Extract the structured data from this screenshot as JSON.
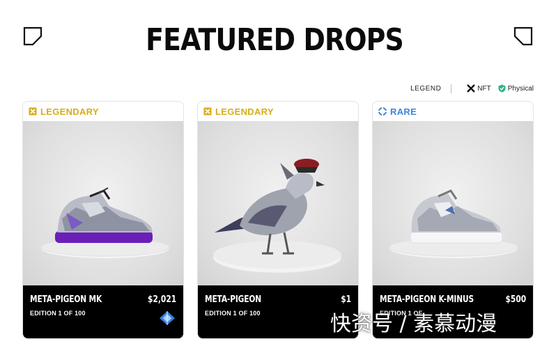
{
  "header": {
    "title": "FEATURED DROPS"
  },
  "legend": {
    "label": "LEGEND",
    "nft_label": "NFT",
    "physical_label": "Physical"
  },
  "cards": [
    {
      "tier": "LEGENDARY",
      "tier_icon": "legendary-icon",
      "tier_color": "#d6ad1a",
      "name": "META-PIGEON MK",
      "price": "$2,021",
      "edition": "EDITION 1 OF 100",
      "image": "purple-silver-sneaker"
    },
    {
      "tier": "LEGENDARY",
      "tier_icon": "legendary-icon",
      "tier_color": "#d6ad1a",
      "name": "META-PIGEON",
      "price": "$1",
      "edition": "EDITION 1 OF 100",
      "image": "chrome-pigeon-sculpture"
    },
    {
      "tier": "RARE",
      "tier_icon": "rare-icon",
      "tier_color": "#3e86d8",
      "name": "META-PIGEON K-MINUS",
      "price": "$500",
      "edition": "EDITION 1 OF",
      "image": "white-silver-sneaker"
    }
  ],
  "watermark": "快资号 / 素慕动漫"
}
